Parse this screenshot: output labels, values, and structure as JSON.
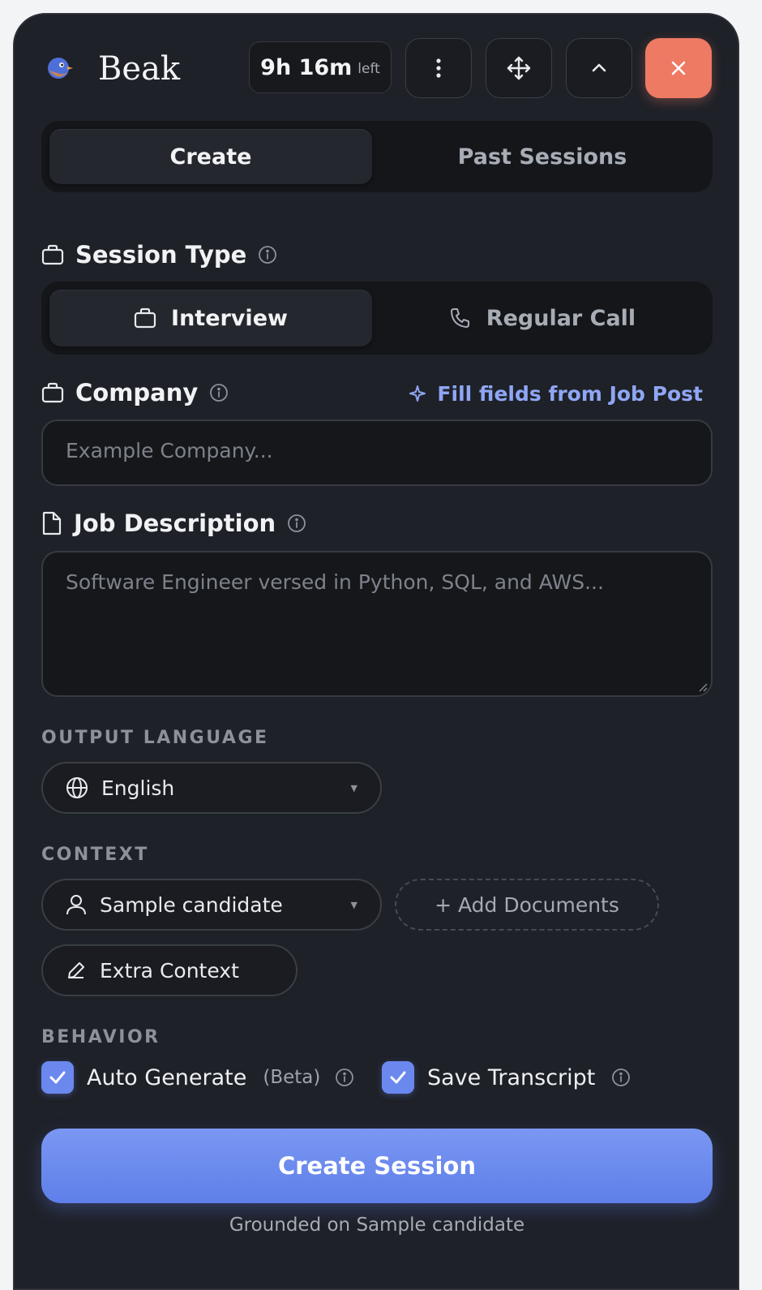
{
  "header": {
    "brand": "Beak",
    "timer_value": "9h 16m",
    "timer_suffix": "left"
  },
  "tabs": [
    {
      "label": "Create",
      "active": true
    },
    {
      "label": "Past Sessions",
      "active": false
    }
  ],
  "session_type": {
    "label": "Session Type",
    "options": [
      {
        "label": "Interview",
        "active": true
      },
      {
        "label": "Regular Call",
        "active": false
      }
    ]
  },
  "company": {
    "label": "Company",
    "fill_link": "Fill fields from Job Post",
    "placeholder": "Example Company..."
  },
  "job_description": {
    "label": "Job Description",
    "placeholder": "Software Engineer versed in Python, SQL, and AWS..."
  },
  "output_language": {
    "heading": "OUTPUT LANGUAGE",
    "selected": "English"
  },
  "context": {
    "heading": "CONTEXT",
    "candidate": "Sample candidate",
    "add_documents": "+ Add Documents",
    "extra_context": "Extra Context"
  },
  "behavior": {
    "heading": "BEHAVIOR",
    "auto_generate": "Auto Generate",
    "auto_generate_tag": "(Beta)",
    "save_transcript": "Save Transcript"
  },
  "cta": {
    "label": "Create Session",
    "footnote": "Grounded on Sample candidate"
  },
  "colors": {
    "panel": "#1e2128",
    "accent": "#6b88ee",
    "close": "#ee7a64",
    "link": "#8fa6f5"
  }
}
